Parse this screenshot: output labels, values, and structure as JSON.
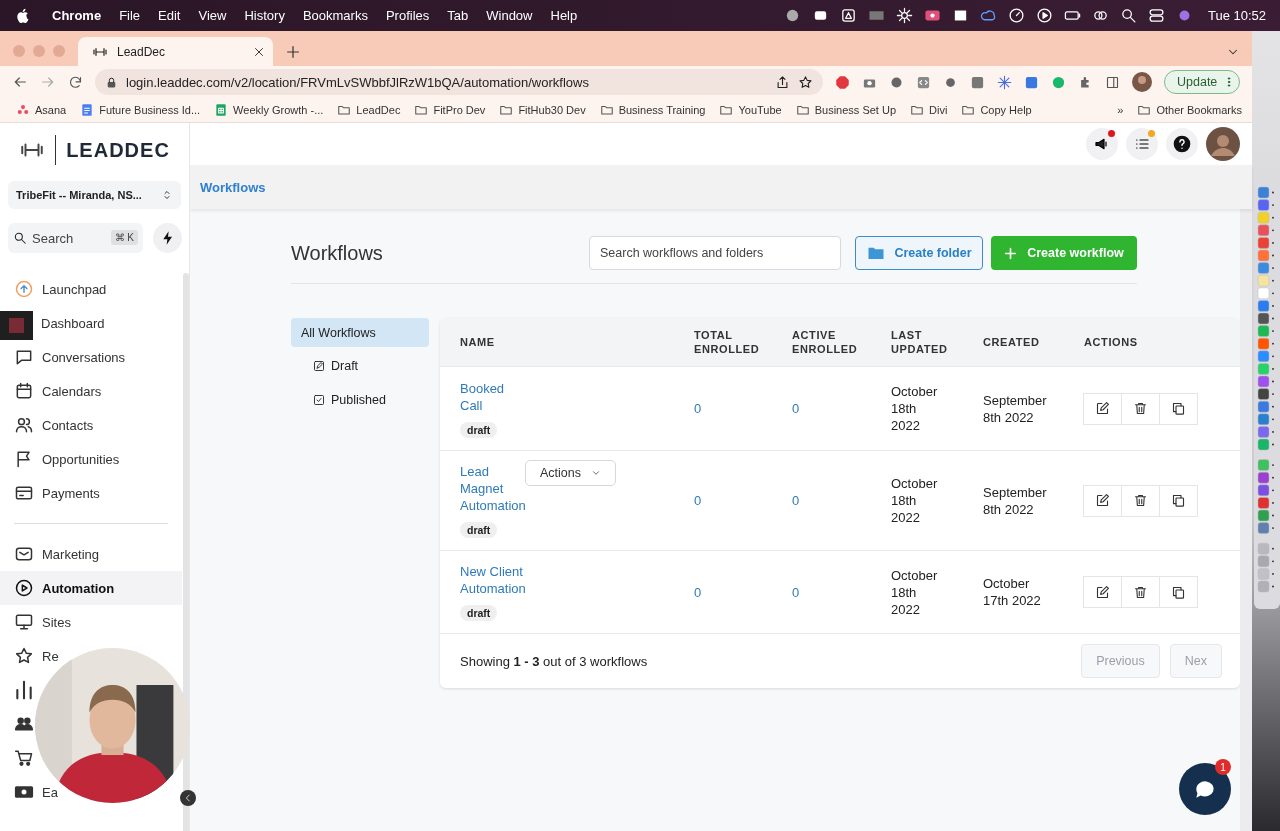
{
  "menubar": {
    "app": "Chrome",
    "menus": [
      "File",
      "Edit",
      "View",
      "History",
      "Bookmarks",
      "Profiles",
      "Tab",
      "Window",
      "Help"
    ],
    "clock": "Tue 10:52"
  },
  "browser": {
    "tab": "LeadDec",
    "url": "login.leaddec.com/v2/location/FRVmLvSWbbfJlRzW1bQA/automation/workflows",
    "update_button": "Update",
    "bookmarks": [
      {
        "label": "Asana",
        "kind": "asana"
      },
      {
        "label": "Future Business Id...",
        "kind": "doc"
      },
      {
        "label": "Weekly Growth -...",
        "kind": "sheet"
      },
      {
        "label": "LeadDec",
        "kind": "folder"
      },
      {
        "label": "FitPro Dev",
        "kind": "folder"
      },
      {
        "label": "FitHub30 Dev",
        "kind": "folder"
      },
      {
        "label": "Business Training",
        "kind": "folder"
      },
      {
        "label": "YouTube",
        "kind": "folder"
      },
      {
        "label": "Business Set Up",
        "kind": "folder"
      },
      {
        "label": "Divi",
        "kind": "folder"
      },
      {
        "label": "Copy Help",
        "kind": "folder"
      }
    ],
    "more": "»",
    "other_bookmarks": "Other Bookmarks"
  },
  "sidebar": {
    "logo": "LEADDEC",
    "location": "TribeFit -- Miranda, NS...",
    "search": {
      "placeholder": "Search",
      "shortcut": "⌘ K"
    },
    "sections": [
      [
        {
          "label": "Launchpad",
          "kind": "launchpad",
          "selected": false
        },
        {
          "label": "Dashboard",
          "kind": "dashboard",
          "selected": false
        },
        {
          "label": "Conversations",
          "kind": "chat",
          "selected": false
        },
        {
          "label": "Calendars",
          "kind": "calendar",
          "selected": false
        },
        {
          "label": "Contacts",
          "kind": "contacts",
          "selected": false
        },
        {
          "label": "Opportunities",
          "kind": "flag",
          "selected": false
        },
        {
          "label": "Payments",
          "kind": "card",
          "selected": false
        }
      ],
      [
        {
          "label": "Marketing",
          "kind": "mail",
          "selected": false
        },
        {
          "label": "Automation",
          "kind": "play",
          "selected": true
        },
        {
          "label": "Sites",
          "kind": "monitor",
          "selected": false
        },
        {
          "label": "Re",
          "kind": "star",
          "selected": false
        },
        {
          "kind": "chart",
          "selected": false
        },
        {
          "kind": "people",
          "selected": false
        },
        {
          "kind": "cart",
          "selected": false
        },
        {
          "label": "Ea",
          "kind": "money",
          "selected": false
        }
      ]
    ]
  },
  "breadcrumb": "Workflows",
  "page": {
    "title": "Workflows",
    "search": {
      "placeholder": "Search workflows and folders"
    },
    "create_folder": "Create folder",
    "create_workflow": "Create workflow"
  },
  "filters": [
    {
      "label": "All Workflows",
      "kind": "all",
      "selected": true
    },
    {
      "label": "Draft",
      "kind": "draft",
      "selected": false
    },
    {
      "label": "Published",
      "kind": "published",
      "selected": false
    }
  ],
  "table": {
    "columns": [
      "NAME",
      "TOTAL ENROLLED",
      "ACTIVE ENROLLED",
      "LAST UPDATED",
      "CREATED",
      "ACTIONS"
    ],
    "rows": [
      {
        "name": "Booked Call",
        "status": "draft",
        "total_enrolled": "0",
        "active_enrolled": "0",
        "last_updated": "October 18th 2022",
        "created": "September 8th 2022"
      },
      {
        "name": "Lead Magnet Automation",
        "status": "draft",
        "menu_button": "Actions",
        "total_enrolled": "0",
        "active_enrolled": "0",
        "last_updated": "October 18th 2022",
        "created": "September 8th 2022"
      },
      {
        "name": "New Client Automation",
        "status": "draft",
        "total_enrolled": "0",
        "active_enrolled": "0",
        "last_updated": "October 18th 2022",
        "created": "October 17th 2022"
      }
    ],
    "summary": "Showing **1 - 3** out of 3 workflows",
    "pagination": [
      {
        "label": "Previous",
        "disabled": true
      },
      {
        "label": "Nex",
        "disabled": true
      }
    ]
  },
  "chat_widget": {
    "badge": "1"
  }
}
